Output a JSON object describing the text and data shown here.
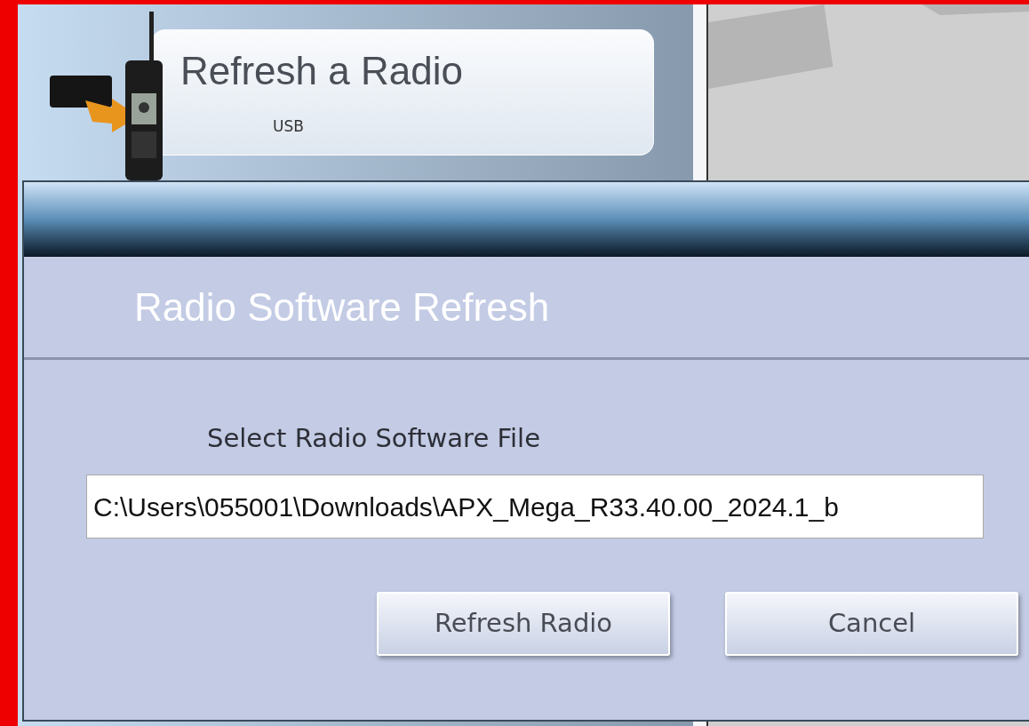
{
  "tile": {
    "title": "Refresh a Radio",
    "subtitle": "USB"
  },
  "dialog": {
    "header": "Radio Software Refresh",
    "field_label": "Select Radio Software File",
    "file_path": "C:\\Users\\055001\\Downloads\\APX_Mega_R33.40.00_2024.1_b",
    "buttons": [
      {
        "label": "Refresh Radio"
      },
      {
        "label": "Cancel"
      }
    ]
  }
}
